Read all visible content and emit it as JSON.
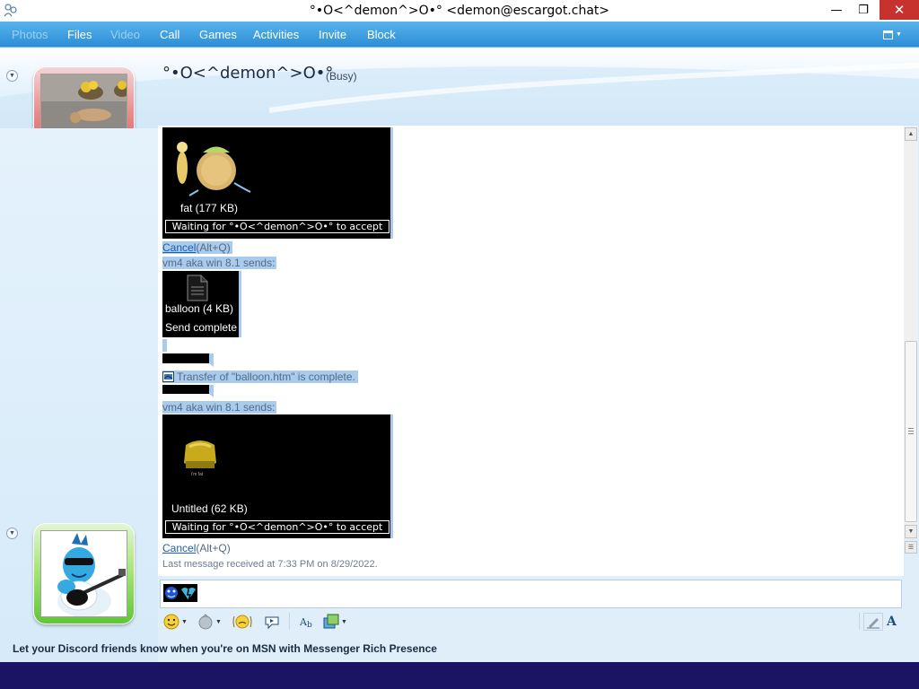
{
  "window": {
    "title": "°•O<^demon^>O•° <demon@escargot.chat>",
    "min_label": "—",
    "max_label": "❐",
    "close_label": "✕"
  },
  "menu": {
    "items": [
      {
        "label": "Photos",
        "enabled": false
      },
      {
        "label": "Files",
        "enabled": true
      },
      {
        "label": "Video",
        "enabled": false
      },
      {
        "label": "Call",
        "enabled": true
      },
      {
        "label": "Games",
        "enabled": true
      },
      {
        "label": "Activities",
        "enabled": true
      },
      {
        "label": "Invite",
        "enabled": true
      },
      {
        "label": "Block",
        "enabled": true
      }
    ]
  },
  "contact": {
    "name": "°•O<^demon^>O•°",
    "status": "(Busy)"
  },
  "transcript": {
    "file1": {
      "name": "fat (177 KB)",
      "status": "Waiting for °•O<^demon^>O•° to accept"
    },
    "cancel1": {
      "link": "Cancel",
      "hotkey": "(Alt+Q)"
    },
    "sends1": "vm4 aka win 8.1 sends:",
    "file2": {
      "name": "balloon (4 KB)",
      "status": "Send complete"
    },
    "transfer_msg": "Transfer of \"balloon.htm\" is complete.",
    "sends2": "vm4 aka win 8.1 sends:",
    "file3": {
      "name": "Untitled (62 KB)",
      "thumb_caption": "i'm fat",
      "status": "Waiting for °•O<^demon^>O•° to accept"
    },
    "cancel2": {
      "link": "Cancel",
      "hotkey": "(Alt+Q)"
    },
    "last_message": "Last message received at 7:33 PM on 8/29/2022."
  },
  "toolbar": {
    "emoticon_icon": "smiley-icon",
    "wink_icon": "wink-icon",
    "nudge_icon": "nudge-icon",
    "voice_clip_icon": "voice-clip-icon",
    "font_icon": "font-icon",
    "background_icon": "background-icon",
    "handwriting_icon": "pen-icon",
    "text_mode_label": "A"
  },
  "footer": {
    "ad_text": "Let your Discord friends know when you're on MSN with Messenger Rich Presence"
  },
  "colors": {
    "menubar": "#2c8ed6",
    "selection": "#a9cbed",
    "link": "#1a5fb4",
    "taskbar": "#1b1464",
    "close_button": "#c7312e"
  }
}
